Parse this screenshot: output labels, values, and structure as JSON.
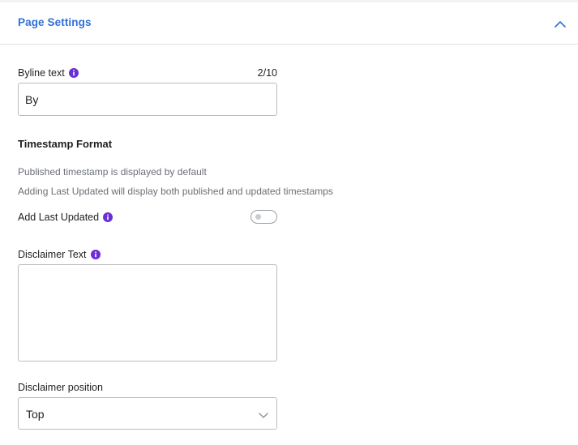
{
  "header": {
    "title": "Page Settings",
    "toggle_icon": "chevron-up-icon"
  },
  "byline": {
    "label": "Byline text",
    "counter": "2/10",
    "value": "By"
  },
  "timestamp": {
    "heading": "Timestamp Format",
    "help_line_1": "Published timestamp is displayed by default",
    "help_line_2": "Adding Last Updated will display both published and updated timestamps",
    "toggle_label": "Add Last Updated",
    "toggle_on": false
  },
  "disclaimer": {
    "label": "Disclaimer Text",
    "value": ""
  },
  "disclaimer_position": {
    "label": "Disclaimer position",
    "selected": "Top"
  },
  "colors": {
    "accent": "#2f6fd8",
    "info_icon": "#6a2fd6",
    "border": "#b9bcc2",
    "help_text": "#6b6f76"
  }
}
